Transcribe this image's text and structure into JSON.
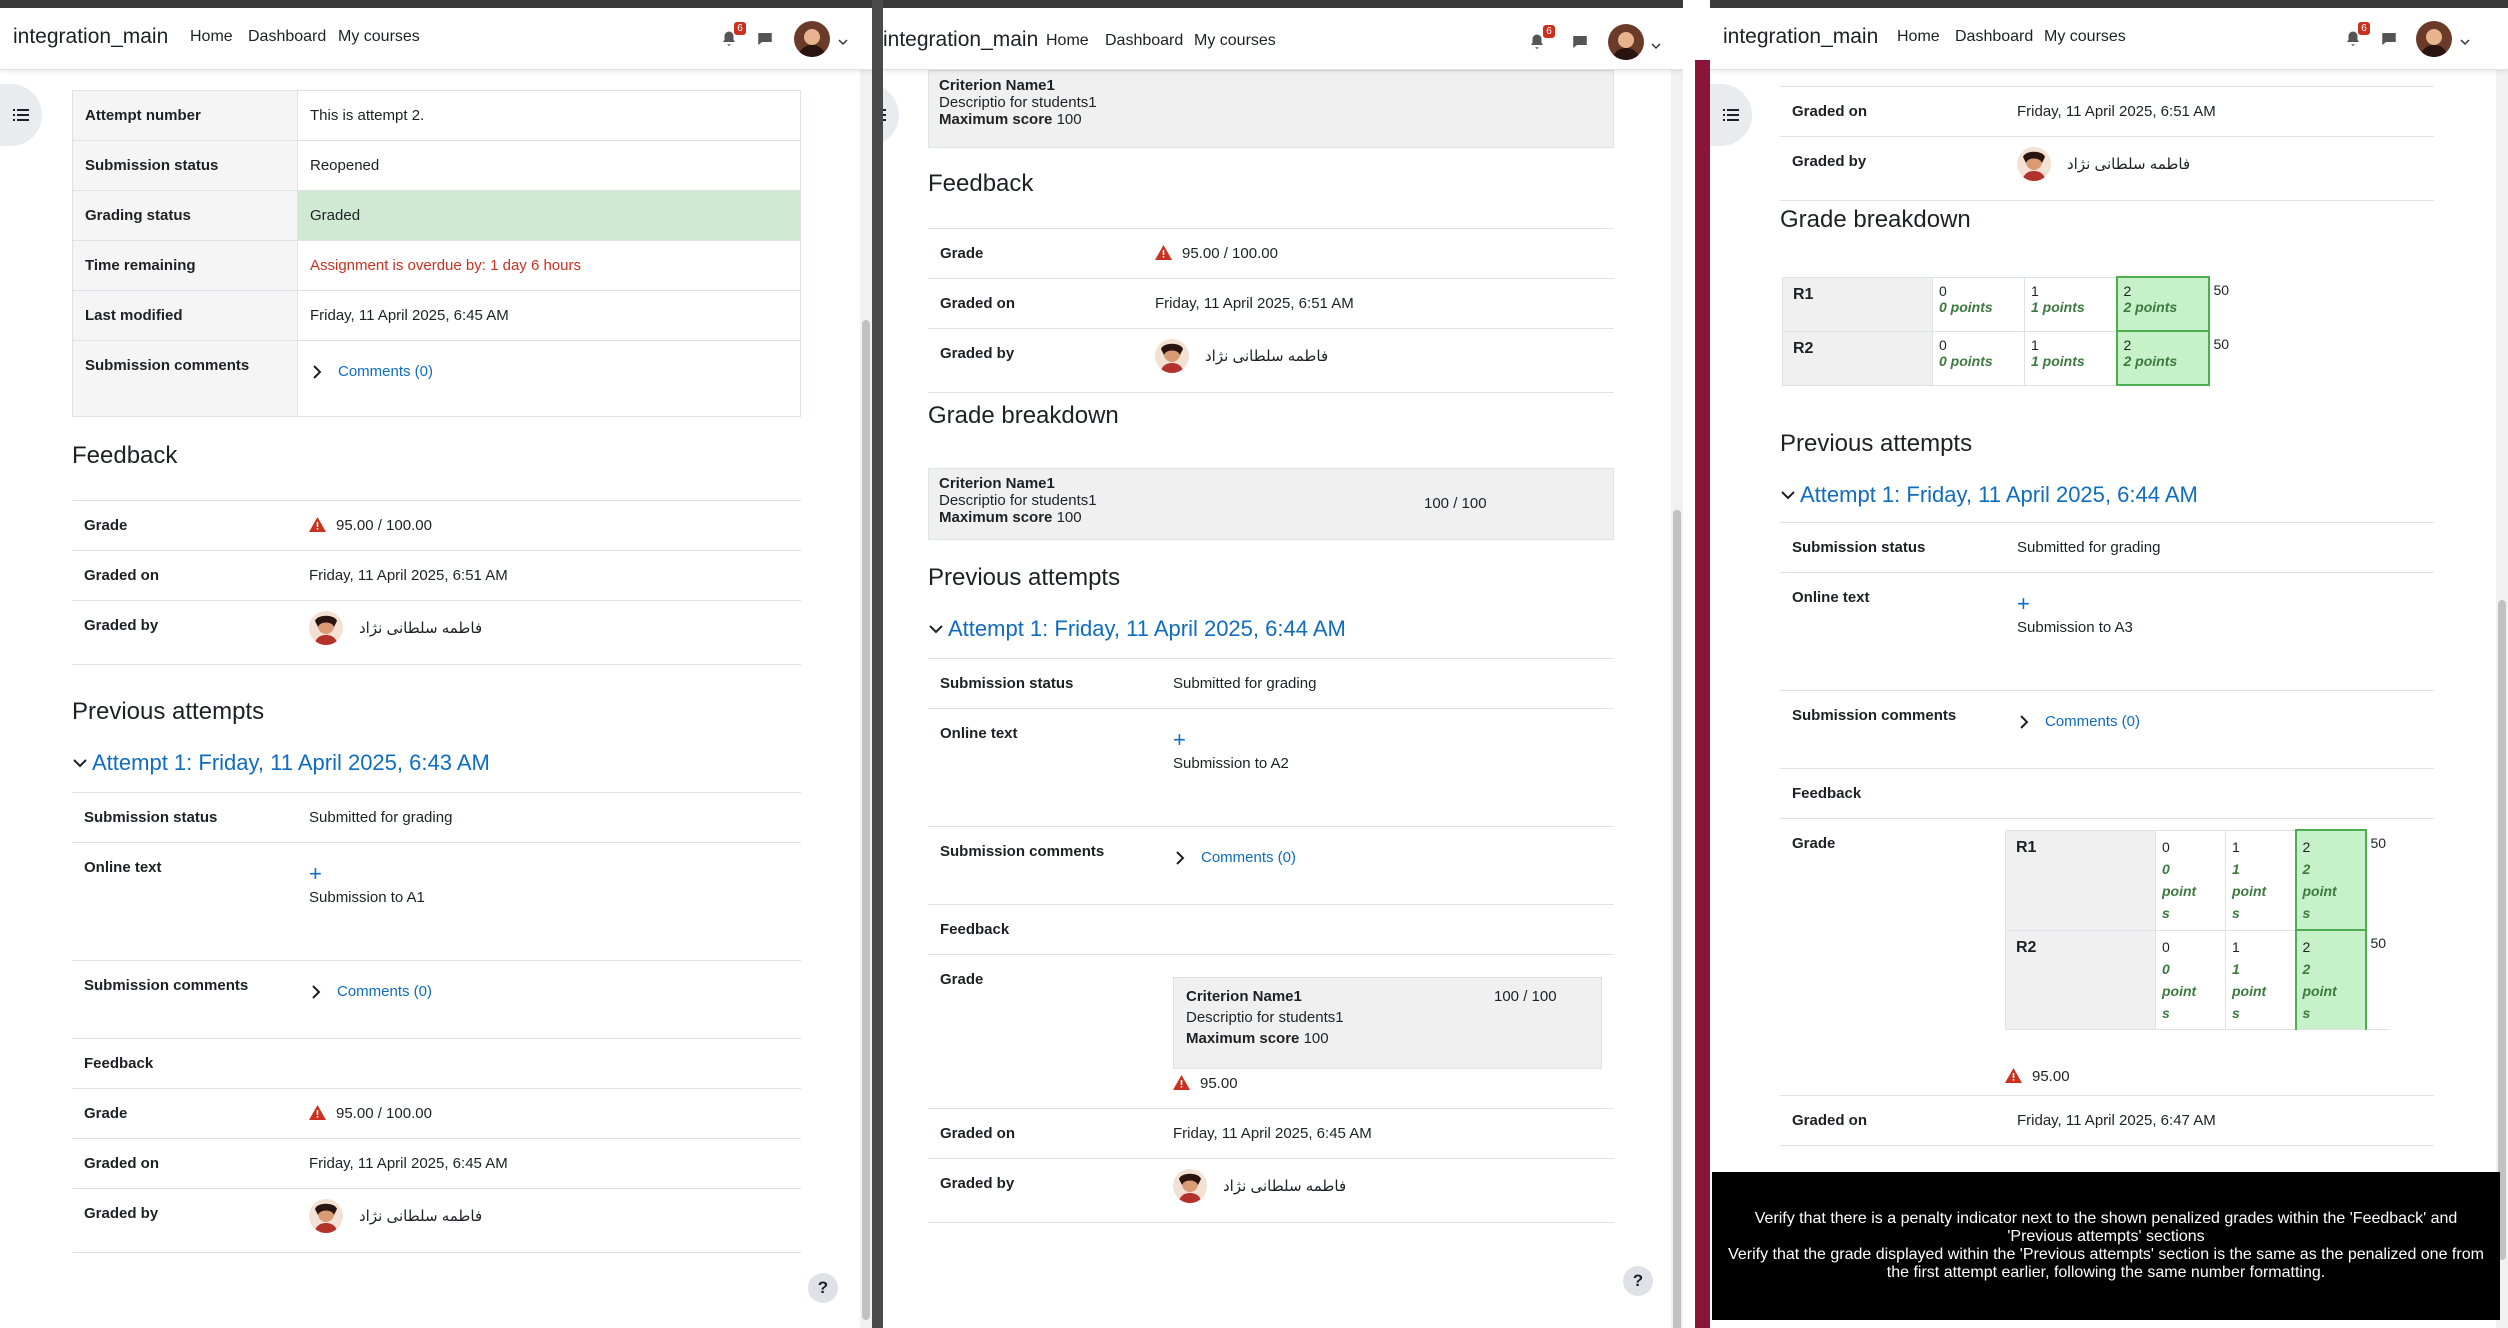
{
  "nav": {
    "brand": "integration_main",
    "links": [
      "Home",
      "Dashboard",
      "My courses"
    ],
    "notif_count": "6"
  },
  "p1": {
    "rows": [
      {
        "label": "Attempt number",
        "value": "This is attempt 2."
      },
      {
        "label": "Submission status",
        "value": "Reopened"
      },
      {
        "label": "Grading status",
        "value": "Graded"
      },
      {
        "label": "Time remaining",
        "value": "Assignment is overdue by: 1 day 6 hours"
      },
      {
        "label": "Last modified",
        "value": "Friday, 11 April 2025, 6:45 AM"
      },
      {
        "label": "Submission comments",
        "value": "Comments (0)"
      }
    ],
    "feedback_title": "Feedback",
    "feedback": {
      "grade_label": "Grade",
      "grade_value": "95.00 / 100.00",
      "graded_on_label": "Graded on",
      "graded_on_value": "Friday, 11 April 2025, 6:51 AM",
      "graded_by_label": "Graded by",
      "graded_by_value": "فاطمه سلطانی نژاد"
    },
    "prev_title": "Previous attempts",
    "attempt_title": "Attempt 1: Friday, 11 April 2025, 6:43 AM",
    "attempt": {
      "status_label": "Submission status",
      "status_value": "Submitted for grading",
      "online_label": "Online text",
      "online_value": "Submission to A1",
      "comments_label": "Submission comments",
      "comments_value": "Comments (0)",
      "feedback_label": "Feedback",
      "grade_label": "Grade",
      "grade_value": "95.00 / 100.00",
      "graded_on_label": "Graded on",
      "graded_on_value": "Friday, 11 April 2025, 6:45 AM",
      "graded_by_label": "Graded by",
      "graded_by_value": "فاطمه سلطانی نژاد"
    }
  },
  "p2": {
    "crit_top": {
      "name": "Criterion Name1",
      "desc": "Descriptio for students1",
      "max_label": "Maximum score",
      "max_value": "100"
    },
    "feedback_title": "Feedback",
    "feedback": {
      "grade_label": "Grade",
      "grade_value": "95.00 / 100.00",
      "graded_on_label": "Graded on",
      "graded_on_value": "Friday, 11 April 2025, 6:51 AM",
      "graded_by_label": "Graded by",
      "graded_by_value": "فاطمه سلطانی نژاد"
    },
    "breakdown_title": "Grade breakdown",
    "crit_break": {
      "name": "Criterion Name1",
      "desc": "Descriptio for students1",
      "max_label": "Maximum score",
      "max_value": "100",
      "score": "100 / 100"
    },
    "prev_title": "Previous attempts",
    "attempt_title": "Attempt 1: Friday, 11 April 2025, 6:44 AM",
    "attempt": {
      "status_label": "Submission status",
      "status_value": "Submitted for grading",
      "online_label": "Online text",
      "online_value": "Submission to A2",
      "comments_label": "Submission comments",
      "comments_value": "Comments (0)",
      "feedback_label": "Feedback",
      "grade_label": "Grade",
      "crit": {
        "name": "Criterion Name1",
        "desc": "Descriptio for students1",
        "max_label": "Maximum score",
        "max_value": "100",
        "score": "100 / 100"
      },
      "grade_value": "95.00",
      "graded_on_label": "Graded on",
      "graded_on_value": "Friday, 11 April 2025, 6:45 AM",
      "graded_by_label": "Graded by",
      "graded_by_value": "فاطمه سلطانی نژاد"
    }
  },
  "p3": {
    "graded_on_label": "Graded on",
    "graded_on_value": "Friday, 11 April 2025, 6:51 AM",
    "graded_by_label": "Graded by",
    "graded_by_value": "فاطمه سلطانی نژاد",
    "breakdown_title": "Grade breakdown",
    "rubric": [
      {
        "name": "R1",
        "levels": [
          {
            "score": "0",
            "pts": "0 points"
          },
          {
            "score": "1",
            "pts": "1 points"
          },
          {
            "score": "2",
            "pts": "2 points"
          }
        ],
        "max": "50"
      },
      {
        "name": "R2",
        "levels": [
          {
            "score": "0",
            "pts": "0 points"
          },
          {
            "score": "1",
            "pts": "1 points"
          },
          {
            "score": "2",
            "pts": "2 points"
          }
        ],
        "max": "50"
      }
    ],
    "prev_title": "Previous attempts",
    "attempt_title": "Attempt 1: Friday, 11 April 2025, 6:44 AM",
    "attempt": {
      "status_label": "Submission status",
      "status_value": "Submitted for grading",
      "online_label": "Online text",
      "online_value": "Submission to A3",
      "comments_label": "Submission comments",
      "comments_value": "Comments (0)",
      "feedback_label": "Feedback",
      "grade_label": "Grade",
      "rubric_pts_lines": [
        [
          "0",
          "point",
          "s"
        ],
        [
          "1",
          "point",
          "s"
        ],
        [
          "2",
          "point",
          "s"
        ]
      ],
      "grade_value": "95.00",
      "graded_on_label": "Graded on",
      "graded_on_value": "Friday, 11 April 2025, 6:47 AM"
    }
  },
  "overlay": {
    "line1": "Verify that there is a penalty indicator next to the shown penalized grades within the 'Feedback' and 'Previous attempts' sections",
    "line2": "Verify that the grade displayed within the 'Previous attempts' section is the same as the penalized one from the first attempt earlier, following the same number formatting."
  },
  "help": "?",
  "colors": {
    "link": "#0f6cbf",
    "warn": "#ca3120",
    "graded_bg": "#cfe9d3",
    "rubric_sel": "#c6f1c9"
  }
}
